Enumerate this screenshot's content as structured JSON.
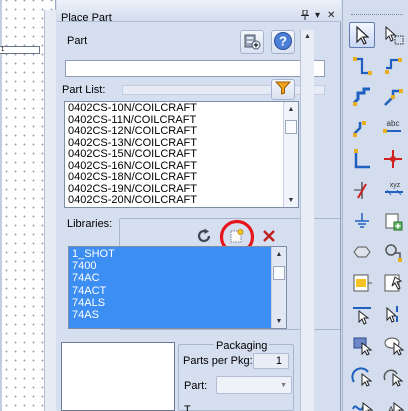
{
  "panel": {
    "title": "Place Part",
    "pin_icon": "pin-icon",
    "dropdown_icon": "chevron-down-icon",
    "close_icon": "close-icon"
  },
  "part": {
    "label": "Part",
    "value": "",
    "add_icon": "add-part-icon",
    "help_icon": "help-icon"
  },
  "part_list": {
    "label": "Part List:",
    "filter_icon": "filter-funnel-icon",
    "items": [
      "0402CS-10N/COILCRAFT",
      "0402CS-11N/COILCRAFT",
      "0402CS-12N/COILCRAFT",
      "0402CS-13N/COILCRAFT",
      "0402CS-15N/COILCRAFT",
      "0402CS-16N/COILCRAFT",
      "0402CS-18N/COILCRAFT",
      "0402CS-19N/COILCRAFT",
      "0402CS-20N/COILCRAFT"
    ]
  },
  "libraries": {
    "label": "Libraries:",
    "refresh_icon": "refresh-icon",
    "add_library_icon": "add-library-icon",
    "remove_icon": "remove-library-icon",
    "highlight_color": "#e8141c",
    "items": [
      "1_SHOT",
      "7400",
      "74AC",
      "74ACT",
      "74ALS",
      "74AS"
    ],
    "selection_color": "#3d8ef2"
  },
  "packaging": {
    "label": "Packaging",
    "parts_per_pkg_label": "Parts per Pkg:",
    "parts_per_pkg_value": "1",
    "part_label": "Part:",
    "part_value": "",
    "type_label": "T"
  },
  "canvas": {
    "tab_text": "1"
  },
  "toolbar": {
    "tools": [
      "select-arrow-icon",
      "zoom-area-icon",
      "wire-icon",
      "net-label-icon",
      "bus-icon",
      "bus-entry-icon",
      "net-alias-icon",
      "text-abc-icon",
      "junction-icon",
      "no-connect-icon",
      "power-symbol-icon",
      "off-page-connector-icon",
      "ground-symbol-icon",
      "place-part-icon",
      "hierarchical-port-icon",
      "place-hierarchical-block-icon",
      "place-pin-icon",
      "place-pin-array-icon",
      "line-icon",
      "polyline-icon",
      "rectangle-icon",
      "ellipse-icon",
      "arc-icon",
      "bezier-icon",
      "text-icon",
      "image-icon"
    ]
  }
}
